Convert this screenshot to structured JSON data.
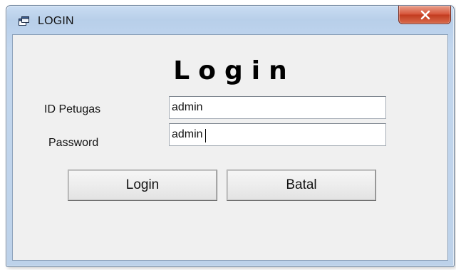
{
  "window": {
    "title": "LOGIN",
    "close_glyph": "x"
  },
  "form": {
    "heading": "Login",
    "id_label": "ID Petugas",
    "id_value": "admin",
    "password_label": "Password",
    "password_value": "admin"
  },
  "buttons": {
    "login_label": "Login",
    "cancel_label": "Batal"
  }
}
